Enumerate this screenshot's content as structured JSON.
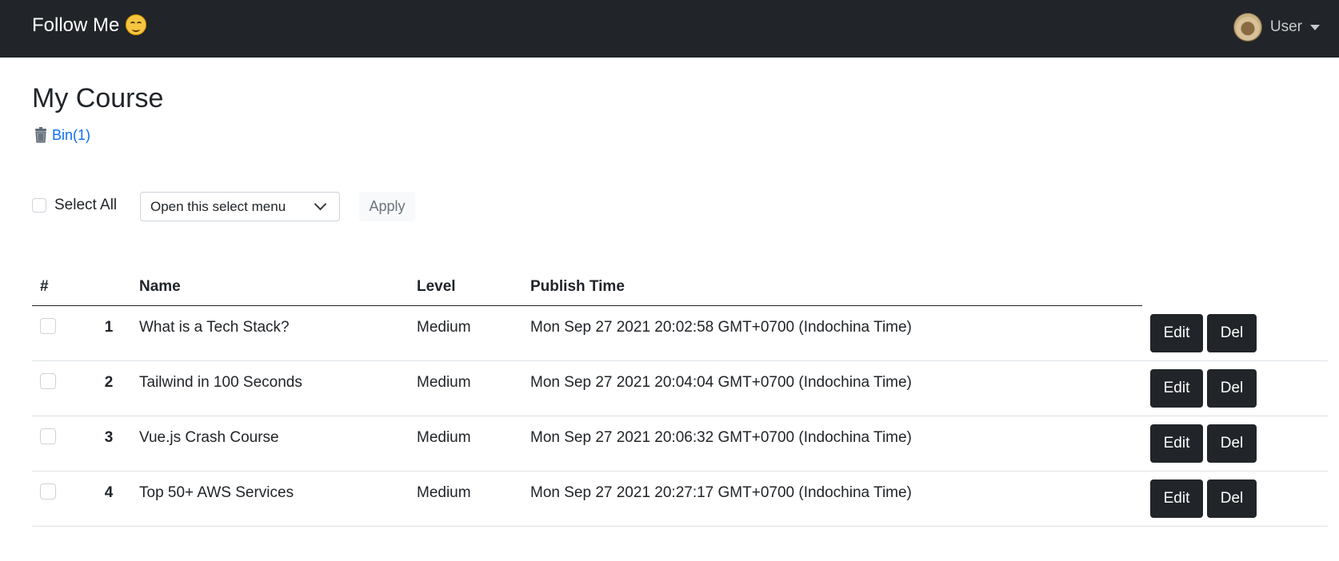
{
  "navbar": {
    "brand": "Follow Me",
    "user_label": "User"
  },
  "page": {
    "title": "My Course",
    "bin_link": "Bin(1)"
  },
  "controls": {
    "select_all_label": "Select All",
    "select_placeholder": "Open this select menu",
    "apply_label": "Apply"
  },
  "table": {
    "headers": [
      "#",
      "Name",
      "Level",
      "Publish Time"
    ],
    "rows": [
      {
        "index": "1",
        "name": "What is a Tech Stack?",
        "level": "Medium",
        "publish_time": "Mon Sep 27 2021 20:02:58 GMT+0700 (Indochina Time)"
      },
      {
        "index": "2",
        "name": "Tailwind in 100 Seconds",
        "level": "Medium",
        "publish_time": "Mon Sep 27 2021 20:04:04 GMT+0700 (Indochina Time)"
      },
      {
        "index": "3",
        "name": "Vue.js Crash Course",
        "level": "Medium",
        "publish_time": "Mon Sep 27 2021 20:06:32 GMT+0700 (Indochina Time)"
      },
      {
        "index": "4",
        "name": "Top 50+ AWS Services",
        "level": "Medium",
        "publish_time": "Mon Sep 27 2021 20:27:17 GMT+0700 (Indochina Time)"
      }
    ],
    "edit_label": "Edit",
    "del_label": "Del"
  },
  "colors": {
    "navbar_bg": "#212529",
    "link": "#0d6efd",
    "button_dark": "#212529"
  }
}
